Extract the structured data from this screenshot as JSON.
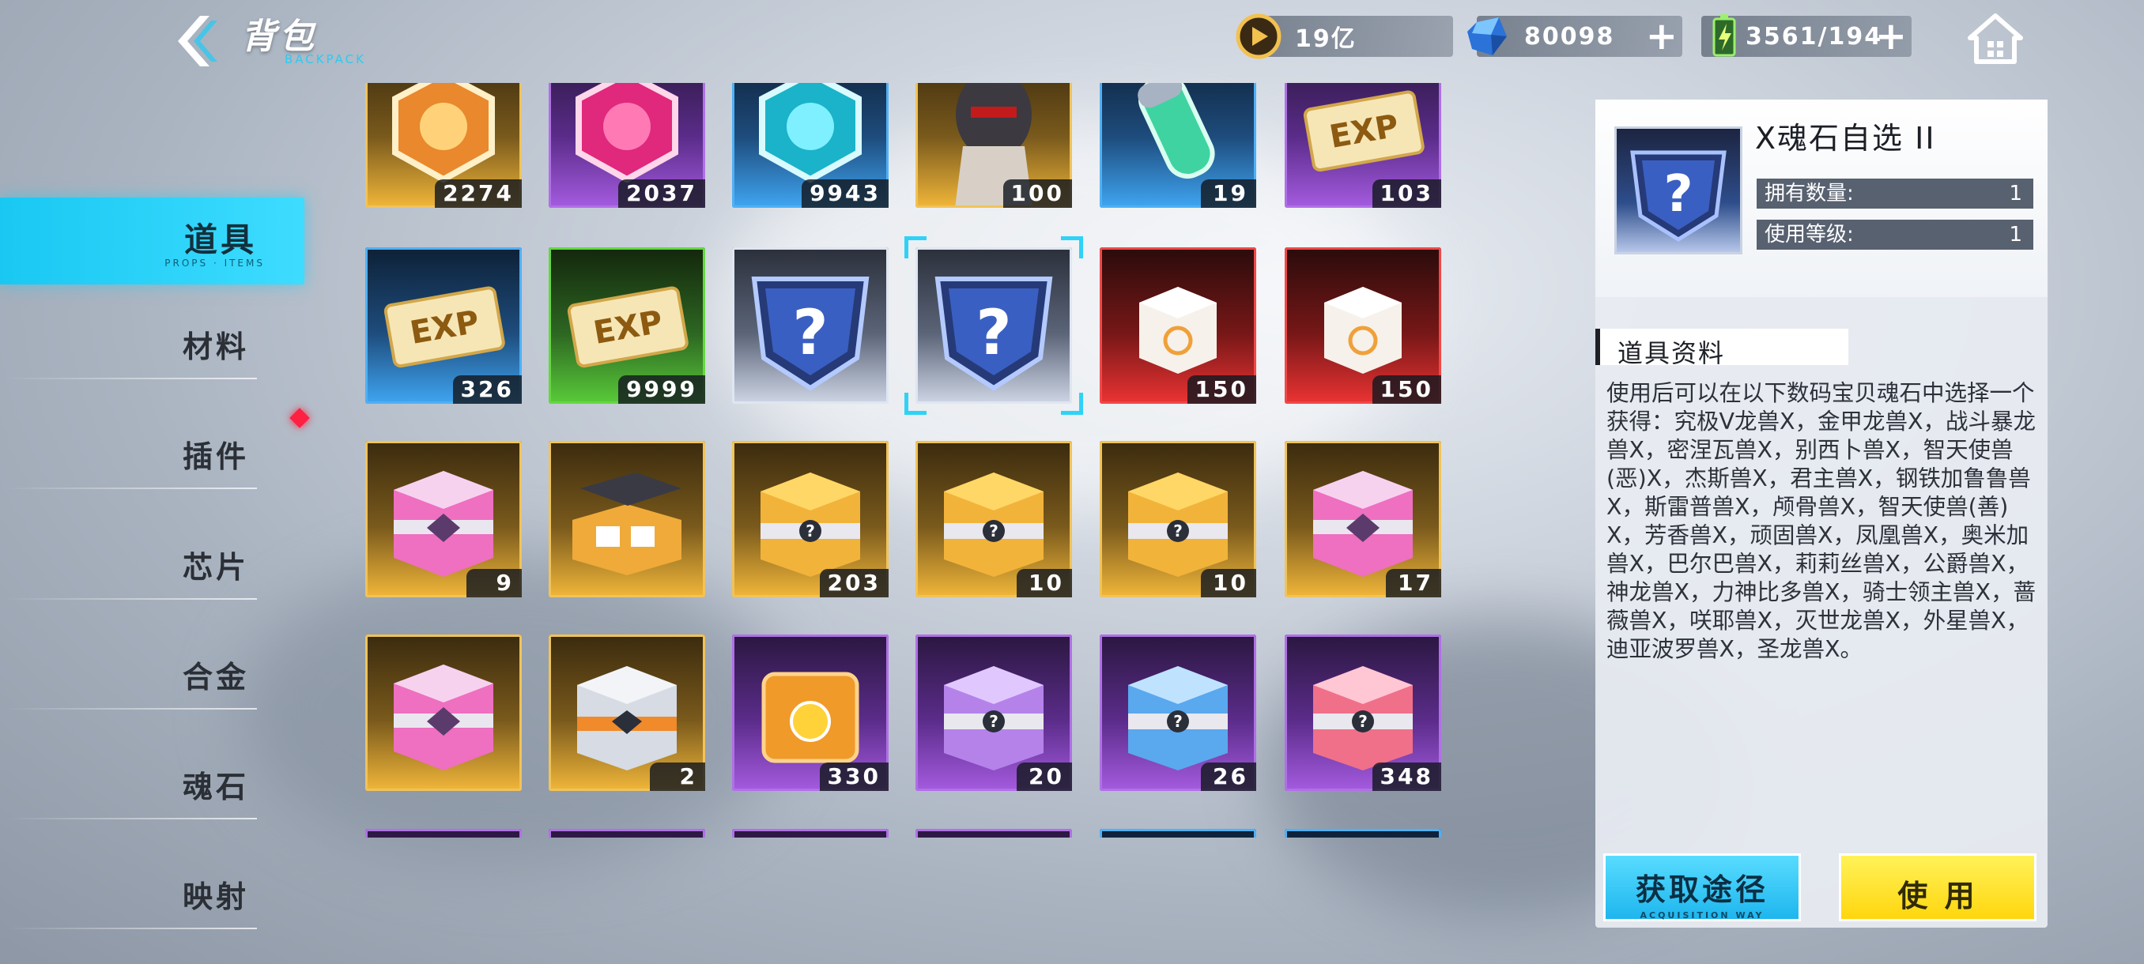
{
  "header": {
    "title": "背包",
    "subtitle": "BACKPACK",
    "resources": [
      {
        "icon": "coin-icon",
        "value": "19亿",
        "has_plus": false
      },
      {
        "icon": "crystal-icon",
        "value": "80098",
        "has_plus": true
      },
      {
        "icon": "battery-icon",
        "value": "3561/194",
        "has_plus": true
      }
    ]
  },
  "sidebar": {
    "items": [
      {
        "label": "道具",
        "active": true,
        "sub": "PROPS · ITEMS"
      },
      {
        "label": "材料",
        "active": false
      },
      {
        "label": "插件",
        "active": false
      },
      {
        "label": "芯片",
        "active": false
      },
      {
        "label": "合金",
        "active": false
      },
      {
        "label": "魂石",
        "active": false
      },
      {
        "label": "映射",
        "active": false
      }
    ]
  },
  "grid": {
    "items": [
      {
        "name": "orange-badge",
        "rarity": "gold",
        "count": "2274",
        "icon": "gold-emblem-icon"
      },
      {
        "name": "pink-badge",
        "rarity": "purple",
        "count": "2037",
        "icon": "pink-emblem-icon"
      },
      {
        "name": "cyan-badge",
        "rarity": "blue",
        "count": "9943",
        "icon": "cyan-emblem-icon"
      },
      {
        "name": "digimon-portrait",
        "rarity": "gold",
        "count": "100",
        "icon": "portrait-icon"
      },
      {
        "name": "green-capsule",
        "rarity": "blue",
        "count": "19",
        "icon": "capsule-icon"
      },
      {
        "name": "exp-ticket-purple",
        "rarity": "purple",
        "count": "103",
        "icon": "exp-ticket-icon"
      },
      {
        "name": "exp-stack-blue",
        "rarity": "blue",
        "count": "326",
        "icon": "exp-ticket-icon"
      },
      {
        "name": "exp-ticket-green",
        "rarity": "green",
        "count": "9999",
        "icon": "exp-ticket-icon"
      },
      {
        "name": "x-soulstone-1",
        "rarity": "white",
        "count": "",
        "icon": "question-shield-icon"
      },
      {
        "name": "x-soulstone-2",
        "rarity": "white",
        "count": "",
        "icon": "question-shield-icon",
        "selected": true
      },
      {
        "name": "white-box-1",
        "rarity": "red",
        "count": "150",
        "icon": "white-box-icon"
      },
      {
        "name": "white-box-2",
        "rarity": "red",
        "count": "150",
        "icon": "white-box-icon"
      },
      {
        "name": "pink-box-1",
        "rarity": "gold",
        "count": "9",
        "icon": "pink-chest-icon"
      },
      {
        "name": "open-case",
        "rarity": "gold",
        "count": "",
        "icon": "open-case-icon"
      },
      {
        "name": "gold-mystery-box-1",
        "rarity": "gold",
        "count": "203",
        "icon": "gold-chest-icon"
      },
      {
        "name": "gold-mystery-box-2",
        "rarity": "gold",
        "count": "10",
        "icon": "gold-chest-icon"
      },
      {
        "name": "gold-mystery-box-3",
        "rarity": "gold",
        "count": "10",
        "icon": "gold-chest-icon"
      },
      {
        "name": "pink-box-2",
        "rarity": "gold",
        "count": "17",
        "icon": "pink-chest-icon"
      },
      {
        "name": "pink-box-3",
        "rarity": "gold",
        "count": "",
        "icon": "pink-chest-icon"
      },
      {
        "name": "silver-box",
        "rarity": "gold",
        "count": "2",
        "icon": "silver-chest-icon"
      },
      {
        "name": "orange-crate",
        "rarity": "purple",
        "count": "330",
        "icon": "orange-crate-icon"
      },
      {
        "name": "purple-mystery-box",
        "rarity": "purple",
        "count": "20",
        "icon": "purple-chest-icon"
      },
      {
        "name": "blue-mystery-box",
        "rarity": "purple",
        "count": "26",
        "icon": "blue-chest-icon"
      },
      {
        "name": "red-mystery-box",
        "rarity": "purple",
        "count": "348",
        "icon": "red-chest-icon"
      }
    ],
    "next_row_rarities": [
      "purple",
      "purple",
      "purple",
      "purple",
      "blue",
      "blue"
    ]
  },
  "detail": {
    "name": "X魂石自选 II",
    "own_label": "拥有数量:",
    "own_value": "1",
    "level_label": "使用等级:",
    "level_value": "1",
    "info_title": "道具资料",
    "description": "使用后可以在以下数码宝贝魂石中选择一个获得：究极V龙兽X，金甲龙兽X，战斗暴龙兽X，密涅瓦兽X，别西卜兽X，智天使兽(恶)X，杰斯兽X，君主兽X，钢铁加鲁鲁兽X，斯雷普兽X，颅骨兽X，智天使兽(善)X，芳香兽X，顽固兽X，凤凰兽X，奥米加兽X，巴尔巴兽X，莉莉丝兽X，公爵兽X，神龙兽X，力神比多兽X，骑士领主兽X，蔷薇兽X，咲耶兽X，灭世龙兽X，外星兽X，迪亚波罗兽X，圣龙兽X。",
    "get_button": "获取途径",
    "get_button_sub": "ACQUISITION WAY",
    "use_button": "使 用"
  },
  "colors": {
    "accent": "#1ec3f0",
    "use_button": "#ffe02a",
    "gold": "#f2b73a",
    "purple": "#a55be0",
    "blue": "#3fa6f2",
    "green": "#59cc39",
    "red": "#ec3333"
  }
}
